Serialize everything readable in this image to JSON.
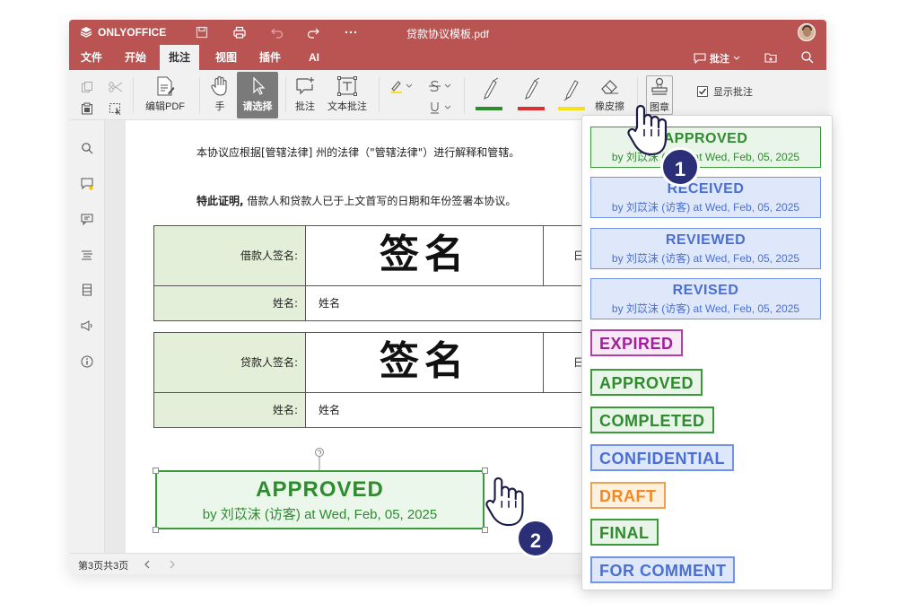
{
  "titlebar": {
    "app_name": "ONLYOFFICE",
    "document_title": "贷款协议模板.pdf"
  },
  "menu": {
    "tabs": [
      "文件",
      "开始",
      "批注",
      "视图",
      "插件",
      "AI"
    ],
    "active_tab": "批注",
    "comments_label": "批注"
  },
  "toolbar": {
    "edit_pdf": "编辑PDF",
    "hand": "手",
    "select": "请选择",
    "comment": "批注",
    "text_comment": "文本批注",
    "eraser": "橡皮擦",
    "stamp": "图章",
    "show_comments": "显示批注",
    "pen_colors": [
      "#2e8b2e",
      "#d93030",
      "#f5e21a"
    ]
  },
  "document": {
    "para1": "本协议应根据[管辖法律] 州的法律（\"管辖法律\"）进行解释和管辖。",
    "para2_bold": "特此证明,",
    "para2_rest": " 借款人和贷款人已于上文首写的日期和年份签署本协议。",
    "table1": {
      "sig_label": "借款人签名:",
      "signature": "签名",
      "name_label": "姓名:",
      "name_value": "姓名",
      "date_prefix": "日"
    },
    "table2": {
      "sig_label": "贷款人签名:",
      "signature": "签名",
      "name_label": "姓名:",
      "name_value": "姓名",
      "date_prefix": "日"
    }
  },
  "placed_stamp": {
    "title": "APPROVED",
    "subtitle": "by 刘苡沫 (访客) at Wed, Feb, 05, 2025"
  },
  "stamp_panel": {
    "detailed": [
      {
        "title": "APPROVED",
        "subtitle": "by 刘苡沫 (访客) at Wed, Feb, 05, 2025",
        "color": "green"
      },
      {
        "title": "RECEIVED",
        "subtitle": "by 刘苡沫 (访客) at Wed, Feb, 05, 2025",
        "color": "blue"
      },
      {
        "title": "REVIEWED",
        "subtitle": "by 刘苡沫 (访客) at Wed, Feb, 05, 2025",
        "color": "blue"
      },
      {
        "title": "REVISED",
        "subtitle": "by 刘苡沫 (访客) at Wed, Feb, 05, 2025",
        "color": "blue"
      }
    ],
    "simple": [
      {
        "title": "EXPIRED",
        "color": "purple"
      },
      {
        "title": "APPROVED",
        "color": "green"
      },
      {
        "title": "COMPLETED",
        "color": "green"
      },
      {
        "title": "CONFIDENTIAL",
        "color": "blue"
      },
      {
        "title": "DRAFT",
        "color": "orange"
      },
      {
        "title": "FINAL",
        "color": "green"
      },
      {
        "title": "FOR COMMENT",
        "color": "blue"
      }
    ]
  },
  "statusbar": {
    "page_info": "第3页共3页"
  },
  "callouts": {
    "step1": "1",
    "step2": "2"
  }
}
